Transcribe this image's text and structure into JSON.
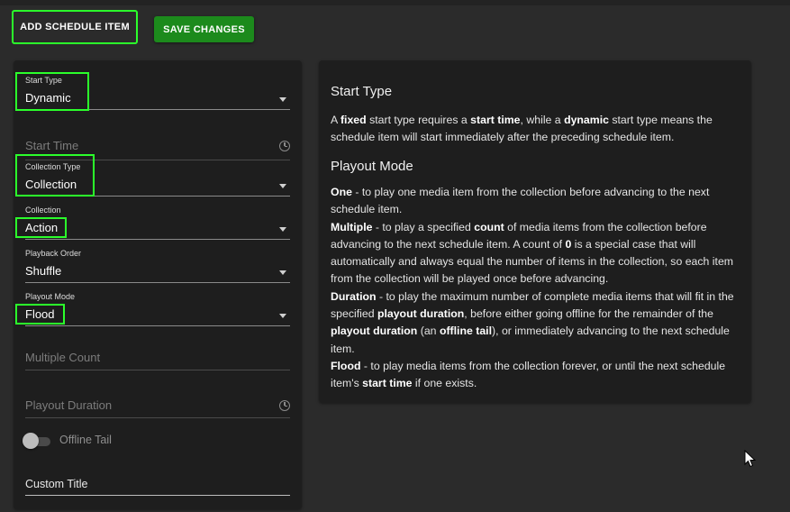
{
  "toolbar": {
    "add_label": "ADD SCHEDULE ITEM",
    "save_label": "SAVE CHANGES"
  },
  "form": {
    "start_type": {
      "label": "Start Type",
      "value": "Dynamic"
    },
    "start_time": {
      "placeholder": "Start Time"
    },
    "collection_type": {
      "label": "Collection Type",
      "value": "Collection"
    },
    "collection": {
      "label": "Collection",
      "value": "Action"
    },
    "playback_order": {
      "label": "Playback Order",
      "value": "Shuffle"
    },
    "playout_mode": {
      "label": "Playout Mode",
      "value": "Flood"
    },
    "multiple_count": {
      "placeholder": "Multiple Count"
    },
    "playout_duration": {
      "placeholder": "Playout Duration"
    },
    "offline_tail": {
      "label": "Offline Tail",
      "enabled": false
    },
    "custom_title": {
      "value": "Custom Title"
    }
  },
  "help": {
    "start_type_title": "Start Type",
    "start_type_text": {
      "p1": "A ",
      "b1": "fixed",
      "p2": " start type requires a ",
      "b2": "start time",
      "p3": ", while a ",
      "b3": "dynamic",
      "p4": " start type means the schedule item will start immediately after the preceding schedule item."
    },
    "playout_mode_title": "Playout Mode",
    "one": {
      "name": "One",
      "text": " - to play one media item from the collection before advancing to the next schedule item."
    },
    "multiple": {
      "name": "Multiple",
      "t1": " - to play a specified ",
      "b1": "count",
      "t2": " of media items from the collection before advancing to the next schedule item. A count of ",
      "b2": "0",
      "t3": " is a special case that will automatically and always equal the number of items in the collection, so each item from the collection will be played once before advancing."
    },
    "duration": {
      "name": "Duration",
      "t1": " - to play the maximum number of complete media items that will fit in the specified ",
      "b1": "playout duration",
      "t2": ", before either going offline for the remainder of the ",
      "b2": "playout duration",
      "t3": " (an ",
      "b3": "offline tail",
      "t4": "), or immediately advancing to the next schedule item."
    },
    "flood": {
      "name": "Flood",
      "t1": " - to play media items from the collection forever, or until the next schedule item's ",
      "b1": "start time",
      "t2": " if one exists."
    }
  },
  "colors": {
    "highlight": "#2bff2b",
    "save_button": "#1c8a1c",
    "panel": "#1e1e1e",
    "background": "#2b2b2b"
  },
  "icons": [
    "clock-icon",
    "dropdown-arrow-icon",
    "mouse-cursor-icon"
  ]
}
